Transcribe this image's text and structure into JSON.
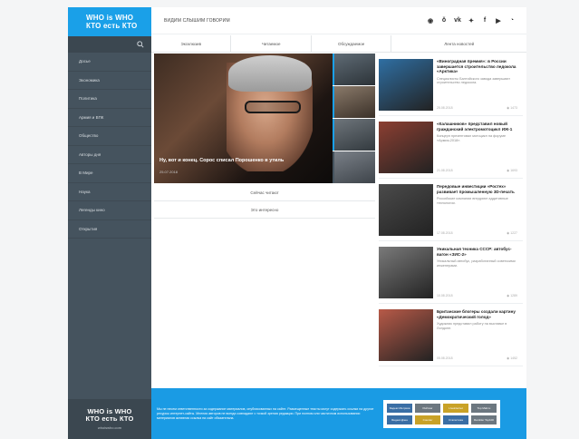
{
  "brand": {
    "logo_line1": "WHO is WHO",
    "logo_line2": "КТО есть КТО",
    "tagline": "ВИДИМ СЛЫШИМ ГОВОРИМ",
    "site": "whoiswho.com"
  },
  "sidebar": {
    "items": [
      {
        "label": "Досье"
      },
      {
        "label": "Экономика"
      },
      {
        "label": "Политика"
      },
      {
        "label": "Армия и ВПК"
      },
      {
        "label": "Общество"
      },
      {
        "label": "Авторы дня"
      },
      {
        "label": "В Мире"
      },
      {
        "label": "Наука"
      },
      {
        "label": "Легенды кино"
      },
      {
        "label": "Открытия"
      }
    ]
  },
  "socials": [
    "globe-icon",
    "odnoklassniki-icon",
    "vk-icon",
    "twitter-icon",
    "facebook-icon",
    "youtube-icon",
    "rss-icon"
  ],
  "tabs": [
    {
      "label": "Эксклюзив"
    },
    {
      "label": "Читаемое"
    },
    {
      "label": "Обсуждаемое"
    },
    {
      "label": "Лента новостей"
    }
  ],
  "hero": {
    "title": "Ну, вот и конец. Сорос списал Порошенко в утиль",
    "date": "25.07.2018"
  },
  "sub_tabs": {
    "now_reading": "Сейчас читают",
    "interesting": "Это интересно"
  },
  "news": [
    {
      "title": "«Виноградная премия»: в России завершается строительство ледокола «Арктика»",
      "desc": "Специалисты Балтийского завода завершают строительство ледокола.",
      "date": "25.08.2018",
      "views": "1473",
      "thumb": "#2f6fa3"
    },
    {
      "title": "«Калашников» представил новый гражданский электромотоцикл ИЖ-1",
      "desc": "Концерн презентовал мотоцикл на форуме «Армия-2018».",
      "date": "21.08.2018",
      "views": "1693",
      "thumb": "#8c3f32"
    },
    {
      "title": "Передовые инвестиции «Ростех» развивает промышленную 3D-печать",
      "desc": "Российские компании внедряют аддитивные технологии.",
      "date": "17.08.2018",
      "views": "1227",
      "thumb": "#4b4b4b"
    },
    {
      "title": "Уникальная техника СССР: автобус-вагон «ЗИС-2»",
      "desc": "Уникальный автобус, разработанный советскими инженерами.",
      "date": "10.08.2018",
      "views": "1289",
      "thumb": "#7a7a7a"
    },
    {
      "title": "Британские блогеры создали картину «Демократический голод»",
      "desc": "Художник представил работу на выставке в Лондоне.",
      "date": "05.08.2018",
      "views": "1452",
      "thumb": "#b85a48"
    }
  ],
  "footer": {
    "text": "Мы не несем ответственности за содержание материалов, опубликованных на сайте. Размещенные тексты могут содержать ссылки на другие ресурсы интернет-сайты. Мнения авторов не всегда совпадают с точкой зрения редакции. При полном или частичном использовании материалов активная ссылка на сайт обязательна.",
    "badges": [
      "Яндекс.Метрика",
      "Рейтинг",
      "Liveinternet",
      "Top Mail.ru",
      "Яндекс.Дзен",
      "Counter",
      "Статистика",
      "Rambler Top100"
    ]
  }
}
